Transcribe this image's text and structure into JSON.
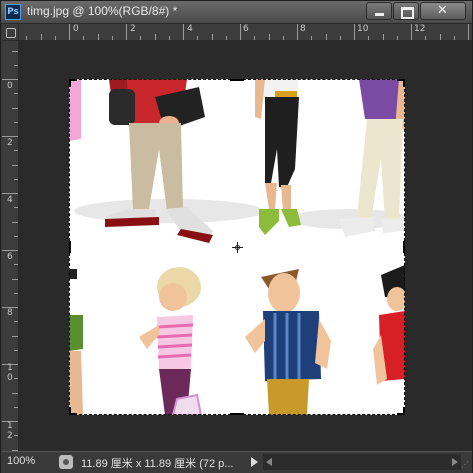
{
  "window": {
    "app_badge": "Ps",
    "title": "timg.jpg @ 100%(RGB/8#) *",
    "close_glyph": "✕",
    "min_icon": "minimize-icon",
    "max_icon": "maximize-icon",
    "close_icon": "close-icon"
  },
  "rulers": {
    "horizontal_labels": [
      "0",
      "2",
      "4",
      "6",
      "8",
      "10",
      "12"
    ],
    "vertical_labels": [
      "0",
      "2",
      "4",
      "6",
      "8",
      "1\n0",
      "1\n2"
    ]
  },
  "document": {
    "image_description_icon": "cartoon-people-image"
  },
  "status": {
    "zoom": "100%",
    "doc_info": "11.89 厘米 x 11.89 厘米 (72 p...",
    "menu_arrow_icon": "status-menu-arrow-icon"
  },
  "colors": {
    "window_bg": "#3a3a3a",
    "canvas_bg": "#2a2a2a",
    "badge_blue": "#0c2a4f"
  }
}
